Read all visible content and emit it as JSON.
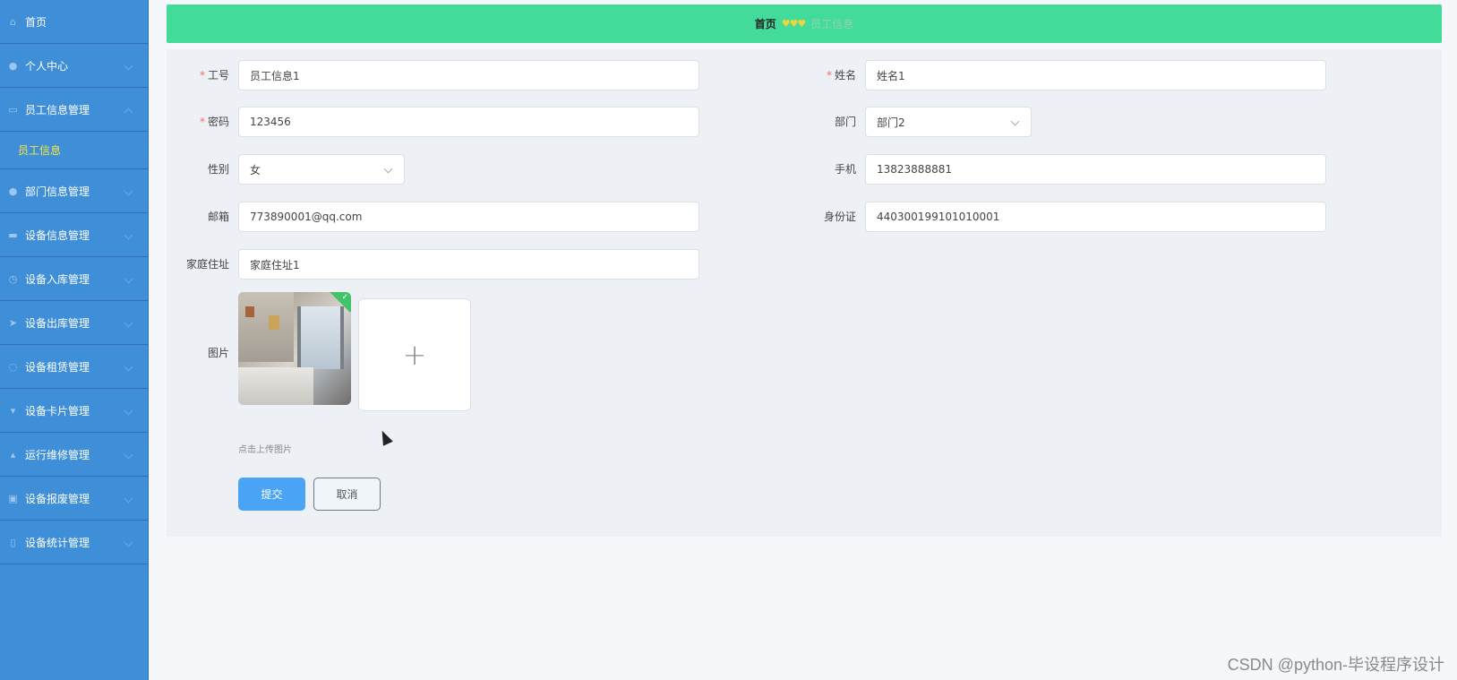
{
  "sidebar": {
    "items": [
      {
        "label": "首页",
        "icon": "home-icon"
      },
      {
        "label": "个人中心",
        "icon": "user-icon"
      },
      {
        "label": "员工信息管理",
        "icon": "chat-icon"
      },
      {
        "label": "部门信息管理",
        "icon": "location-icon"
      },
      {
        "label": "设备信息管理",
        "icon": "monitor-icon"
      },
      {
        "label": "设备入库管理",
        "icon": "clock-icon"
      },
      {
        "label": "设备出库管理",
        "icon": "send-icon"
      },
      {
        "label": "设备租赁管理",
        "icon": "power-icon"
      },
      {
        "label": "设备卡片管理",
        "icon": "card-icon"
      },
      {
        "label": "运行维修管理",
        "icon": "tool-icon"
      },
      {
        "label": "设备报废管理",
        "icon": "briefcase-icon"
      },
      {
        "label": "设备统计管理",
        "icon": "phone-icon"
      }
    ],
    "subitem": "员工信息"
  },
  "header": {
    "home": "首页",
    "hearts": "♥♥♥",
    "crumb": "员工信息"
  },
  "form": {
    "emp_no": {
      "label": "工号",
      "value": "员工信息1"
    },
    "name": {
      "label": "姓名",
      "value": "姓名1"
    },
    "password": {
      "label": "密码",
      "value": "123456"
    },
    "dept": {
      "label": "部门",
      "value": "部门2"
    },
    "gender": {
      "label": "性别",
      "value": "女"
    },
    "phone": {
      "label": "手机",
      "value": "13823888881"
    },
    "email": {
      "label": "邮箱",
      "value": "773890001@qq.com"
    },
    "idcard": {
      "label": "身份证",
      "value": "440300199101010001"
    },
    "address": {
      "label": "家庭住址",
      "value": "家庭住址1"
    },
    "image": {
      "label": "图片",
      "hint": "点击上传图片",
      "add": "+"
    },
    "required_mark": "*"
  },
  "buttons": {
    "submit": "提交",
    "cancel": "取消"
  },
  "watermark": "CSDN @python-毕设程序设计",
  "colors": {
    "sidebar": "#3f8fd8",
    "header": "#42db9a",
    "primary": "#4aa3f5",
    "active_sub": "#f8e73e"
  }
}
